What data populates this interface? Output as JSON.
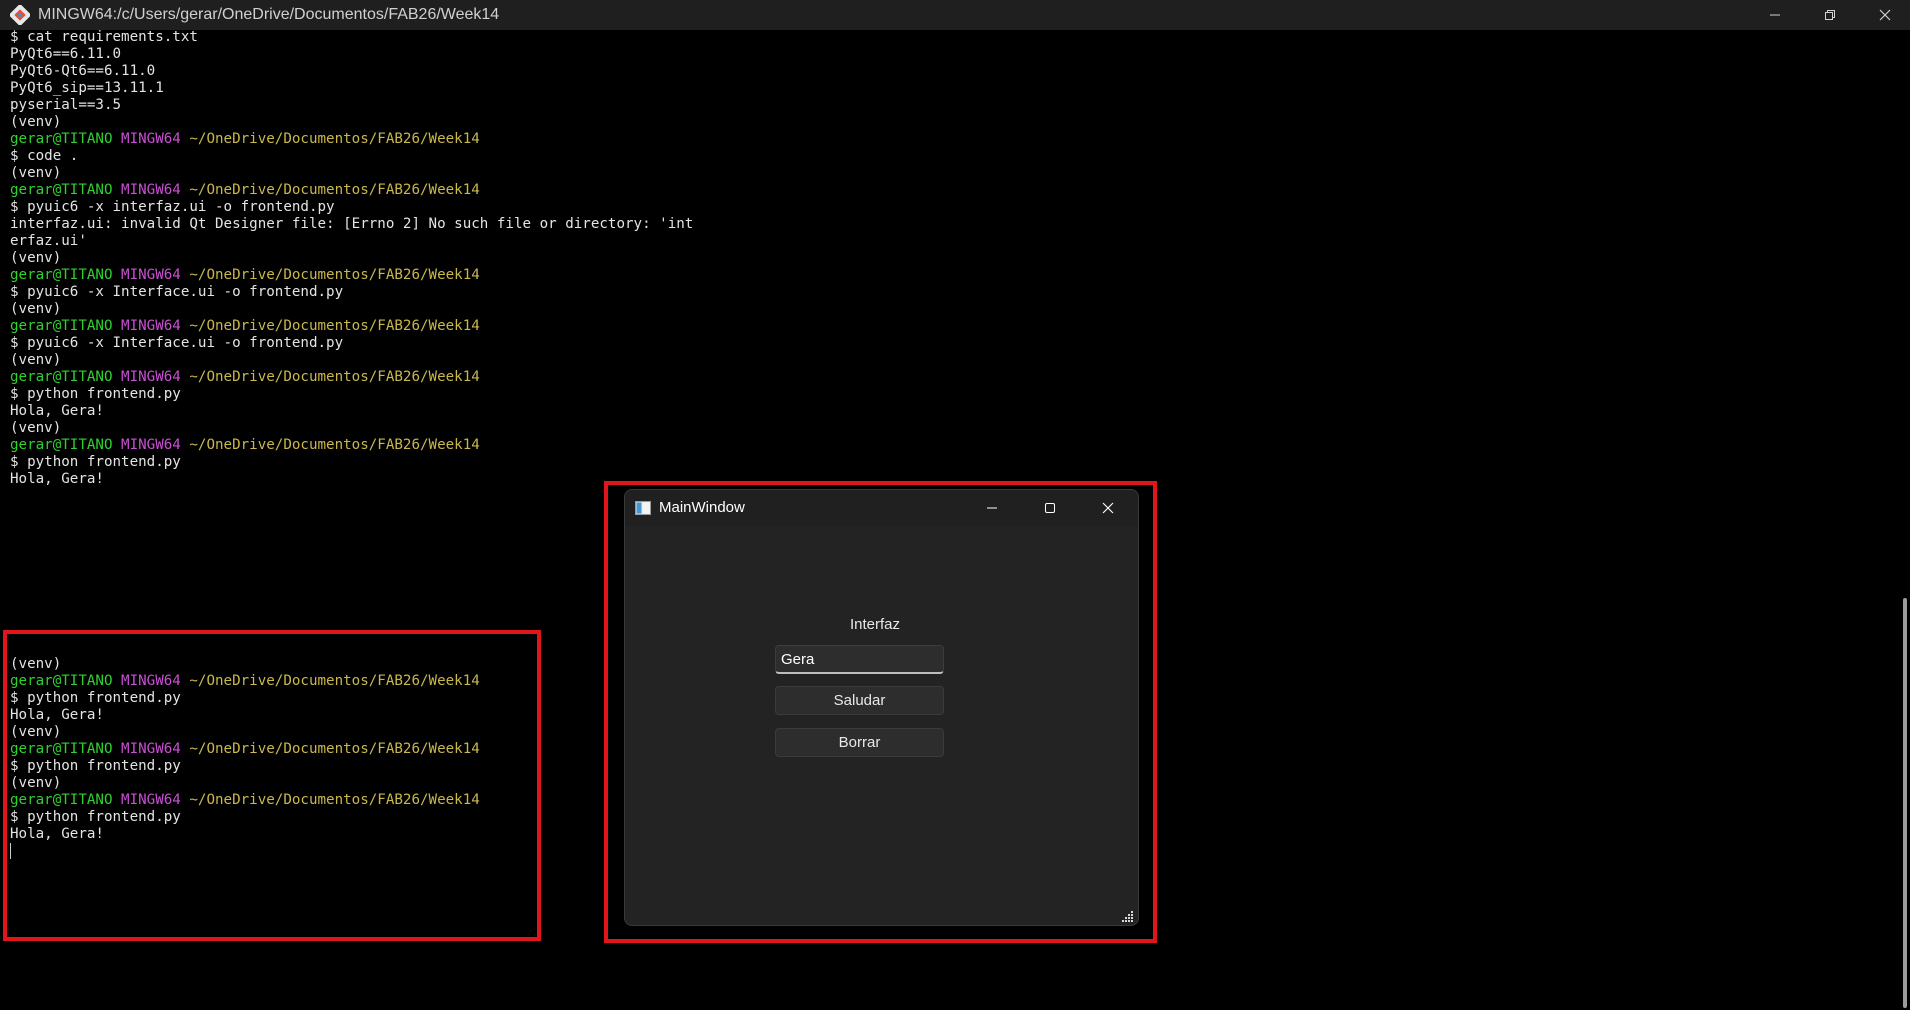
{
  "terminal": {
    "title": "MINGW64:/c/Users/gerar/OneDrive/Documentos/FAB26/Week14",
    "colors": {
      "background": "#000000",
      "text": "#e4e4e4",
      "user": "#2fd12f",
      "mingw": "#c94fd4",
      "path": "#c9b84a"
    },
    "output_lines": [
      "$ cat requirements.txt",
      "PyQt6==6.11.0",
      "PyQt6-Qt6==6.11.0",
      "PyQt6_sip==13.11.1",
      "pyserial==3.5",
      "(venv)",
      "$ code .",
      "(venv)",
      "$ pyuic6 -x interfaz.ui -o frontend.py",
      "interfaz.ui: invalid Qt Designer file: [Errno 2] No such file or directory: 'int",
      "erfaz.ui'",
      "(venv)",
      "$ pyuic6 -x Interface.ui -o frontend.py",
      "(venv)",
      "$ pyuic6 -x Interface.ui -o frontend.py",
      "(venv)",
      "$ python frontend.py",
      "Hola, Gera!",
      "(venv)",
      "$ python frontend.py",
      "Hola, Gera!"
    ],
    "lower_lines": [
      "(venv)",
      "$ python frontend.py",
      "Hola, Gera!",
      "(venv)",
      "$ python frontend.py",
      "(venv)",
      "$ python frontend.py",
      "Hola, Gera!"
    ],
    "prompt": {
      "user": "gerar@TITANO",
      "shell": "MINGW64",
      "path": "~/OneDrive/Documentos/FAB26/Week14"
    }
  },
  "app": {
    "title": "MainWindow",
    "label": "Interfaz",
    "input_value": "Gera",
    "button_greet": "Saludar",
    "button_clear": "Borrar"
  },
  "annotations": {
    "highlight_color": "#e0161b"
  }
}
